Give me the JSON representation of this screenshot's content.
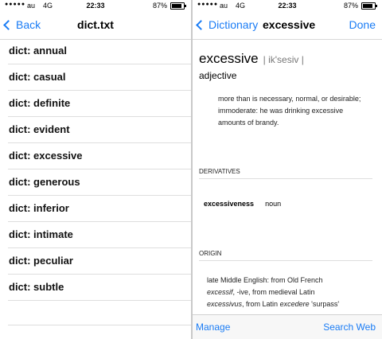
{
  "left_status": {
    "carrier": "au",
    "network": "4G",
    "time": "22:33",
    "battery": "87%",
    "battery_level": 0.87
  },
  "right_status": {
    "carrier": "au",
    "network": "4G",
    "time": "22:33",
    "battery": "87%",
    "battery_level": 0.87
  },
  "list_view": {
    "back_label": "Back",
    "title": "dict.txt",
    "items": [
      "dict: annual",
      "dict: casual",
      "dict: definite",
      "dict: evident",
      "dict: excessive",
      "dict: generous",
      "dict: inferior",
      "dict: intimate",
      "dict: peculiar",
      "dict: subtle"
    ]
  },
  "dictionary_view": {
    "back_label": "Dictionary",
    "title": "excessive",
    "done_label": "Done",
    "headword": "excessive",
    "pronunciation": "| ik'sesiv |",
    "part_of_speech": "adjective",
    "definition_main": "more than is necessary, normal, or desirable; immoderate:",
    "definition_example": "he was drinking excessive amounts of brandy.",
    "derivatives_heading": "DERIVATIVES",
    "derivative_word": "excessiveness",
    "derivative_pos": "noun",
    "origin_heading": "ORIGIN",
    "origin_line1": "late Middle English: from Old French",
    "origin_t1": "excessif",
    "origin_t2": ", -ive",
    "origin_t3": ", from medieval Latin",
    "origin_t4": "excessivus",
    "origin_t5": ", from Latin",
    "origin_t6": "excedere",
    "origin_t7": "'surpass'",
    "manage_label": "Manage",
    "search_web_label": "Search Web"
  }
}
